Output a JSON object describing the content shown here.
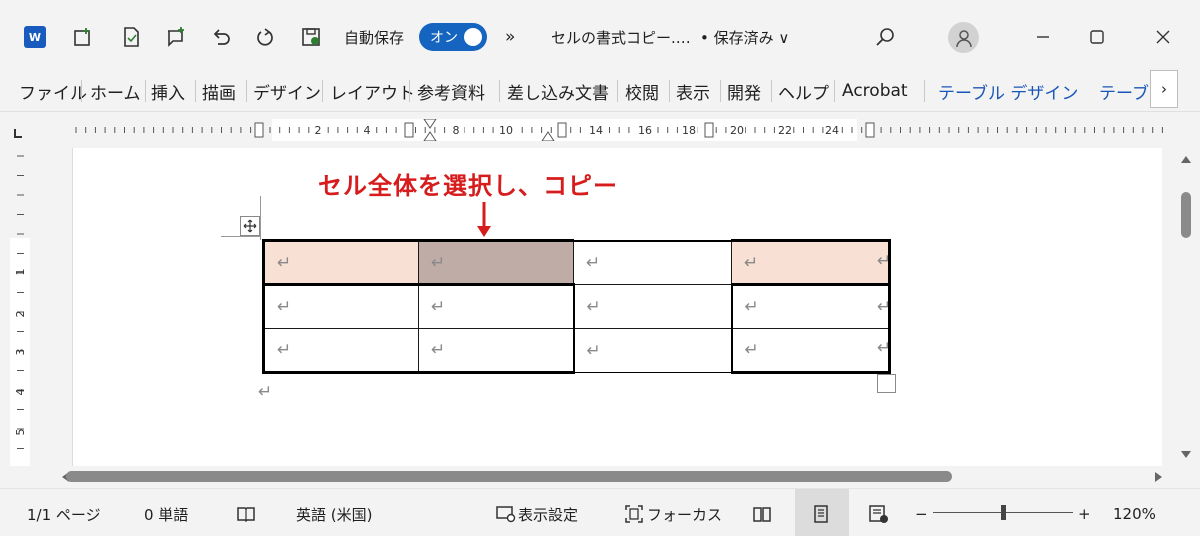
{
  "titlebar": {
    "autosave_label": "自動保存",
    "autosave_toggle": "オン",
    "more_commands": "»",
    "doc_title": "セルの書式コピー.…",
    "save_status": "• 保存済み ∨"
  },
  "menu": {
    "items": [
      "ファイル",
      "ホーム",
      "挿入",
      "描画",
      "デザイン",
      "レイアウト",
      "参考資料",
      "差し込み文書",
      "校閲",
      "表示",
      "開発",
      "ヘルプ",
      "Acrobat"
    ],
    "context_tabs": [
      "テーブル デザイン",
      "テーブ"
    ],
    "scroll_right": "›"
  },
  "ruler": {
    "labels": [
      "2",
      "4",
      "8",
      "10",
      "14",
      "16",
      "18",
      "20",
      "22",
      "24"
    ],
    "vertical_labels": [
      "1",
      "2",
      "3",
      "4",
      "5",
      "6"
    ]
  },
  "document": {
    "annotation": "セル全体を選択し、コピー",
    "arrow": "↓",
    "para_mark": "↵",
    "table": {
      "rows": 3,
      "cols": 4,
      "highlight_light": "#f9e0d5",
      "highlight_dark": "#bfaca6"
    }
  },
  "statusbar": {
    "page": "1/1 ページ",
    "words": "0 単語",
    "language": "英語 (米国)",
    "display_settings": "表示設定",
    "focus": "フォーカス",
    "zoom_minus": "−",
    "zoom_plus": "+",
    "zoom": "120%"
  },
  "colors": {
    "accent": "#1565c0",
    "annotation": "#d61c1c",
    "context_tab": "#1a56b8"
  }
}
